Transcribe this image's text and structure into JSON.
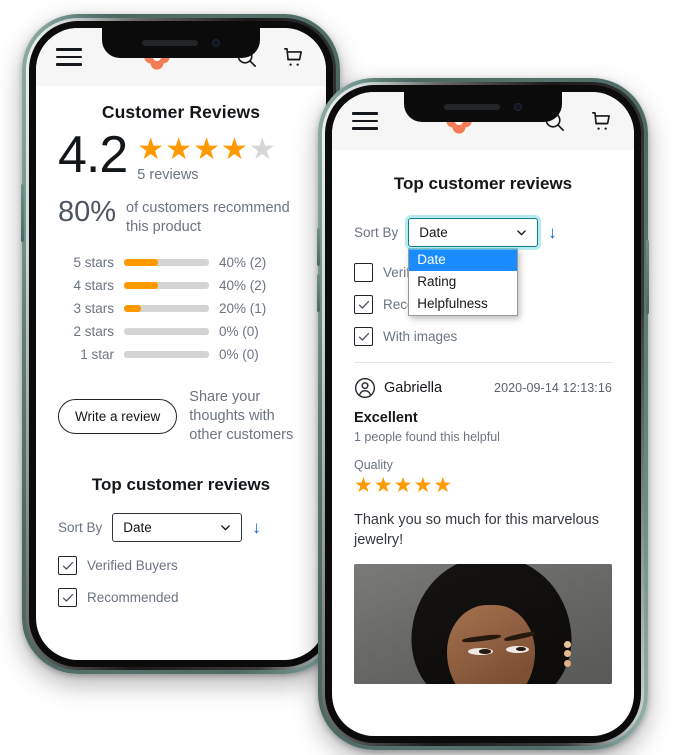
{
  "accent": {
    "star_orange": "#FF9900",
    "logo_orange": "#F2693C",
    "dropdown_select_blue": "#1A8CFF",
    "sort_arrow_blue": "#0B63C5",
    "phone_frame_green": "#5D7C76",
    "focus_ring_teal": "#0F7F86"
  },
  "header": {
    "menu_icon": "hamburger-menu-icon",
    "logo_icon": "brand-flower-logo",
    "search_icon": "search-icon",
    "cart_icon": "shopping-cart-icon"
  },
  "phone1": {
    "page_title": "Customer Reviews",
    "score": "4.2",
    "stars_filled": 4,
    "stars_total": 5,
    "reviews_count": "5 reviews",
    "recommend_pct": "80%",
    "recommend_text": "of customers recommend this product",
    "rating_bars": [
      {
        "label": "5 stars",
        "fill": 40,
        "value": "40% (2)"
      },
      {
        "label": "4 stars",
        "fill": 40,
        "value": "40% (2)"
      },
      {
        "label": "3 stars",
        "fill": 20,
        "value": "20% (1)"
      },
      {
        "label": "2 stars",
        "fill": 0,
        "value": "0% (0)"
      },
      {
        "label": "1 star",
        "fill": 0,
        "value": "0% (0)"
      }
    ],
    "write_review_label": "Write a review",
    "cta_text": "Share your thoughts with other customers",
    "section_title": "Top customer reviews",
    "sort_label": "Sort By",
    "sort_value": "Date",
    "sort_direction": "↓",
    "filters": [
      {
        "label": "Verified Buyers",
        "checked": true
      },
      {
        "label": "Recommended",
        "checked": true
      }
    ]
  },
  "phone2": {
    "section_title": "Top customer reviews",
    "sort_label": "Sort By",
    "sort_value": "Date",
    "sort_direction": "↓",
    "sort_options": [
      "Date",
      "Rating",
      "Helpfulness"
    ],
    "sort_selected_option": "Date",
    "dropdown_open": true,
    "filters": [
      {
        "label": "Verified Buyers",
        "checked": false
      },
      {
        "label": "Recommended",
        "checked": true
      },
      {
        "label": "With images",
        "checked": true
      }
    ],
    "review": {
      "author": "Gabriella",
      "date": "2020-09-14 12:13:16",
      "title": "Excellent",
      "helpful": "1 people found this helpful",
      "attribute_label": "Quality",
      "attribute_stars": 5,
      "body": "Thank you so much for this marvelous jewelry!",
      "photo_alt": "customer-review-photo"
    }
  }
}
